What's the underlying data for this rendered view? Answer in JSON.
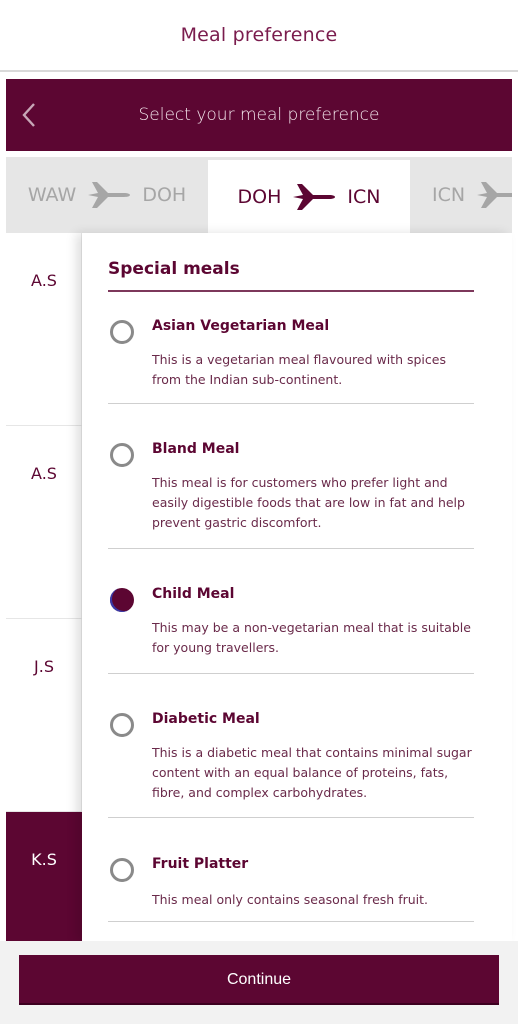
{
  "header": {
    "title": "Meal preference"
  },
  "subheader": {
    "title": "Select your meal preference",
    "back_icon": "chevron-left-icon"
  },
  "segments": [
    {
      "from": "WAW",
      "to": "DOH",
      "icon": "plane-icon"
    },
    {
      "from": "DOH",
      "to": "ICN",
      "icon": "plane-icon",
      "selected": true
    },
    {
      "from": "ICN",
      "to": "",
      "icon": "plane-icon"
    }
  ],
  "passengers": [
    {
      "label": "A.S"
    },
    {
      "label": "A.S"
    },
    {
      "label": "J.S"
    },
    {
      "label": "K.S",
      "selected": true
    }
  ],
  "section": {
    "title": "Special meals"
  },
  "meals": [
    {
      "name": "Asian Vegetarian Meal",
      "description": "This is a vegetarian meal flavoured with spices from the Indian sub-continent.",
      "selected": false
    },
    {
      "name": "Bland Meal",
      "description": "This meal is for customers who prefer light and easily digestible foods that are low in fat and help prevent gastric discomfort.",
      "selected": false
    },
    {
      "name": "Child Meal",
      "description": "This may be a non-vegetarian meal that is suitable for young travellers.",
      "selected": true
    },
    {
      "name": "Diabetic Meal",
      "description": "This is a diabetic meal that contains minimal sugar content with an equal balance of proteins, fats, fibre, and complex carbohydrates.",
      "selected": false
    },
    {
      "name": "Fruit Platter",
      "description": "This meal only contains seasonal fresh fruit.",
      "selected": false
    }
  ],
  "footer": {
    "continue_label": "Continue"
  },
  "colors": {
    "brand": "#5c0632",
    "inactive_tab": "#e6e6e6",
    "inactive_text": "#a6a6a6"
  }
}
